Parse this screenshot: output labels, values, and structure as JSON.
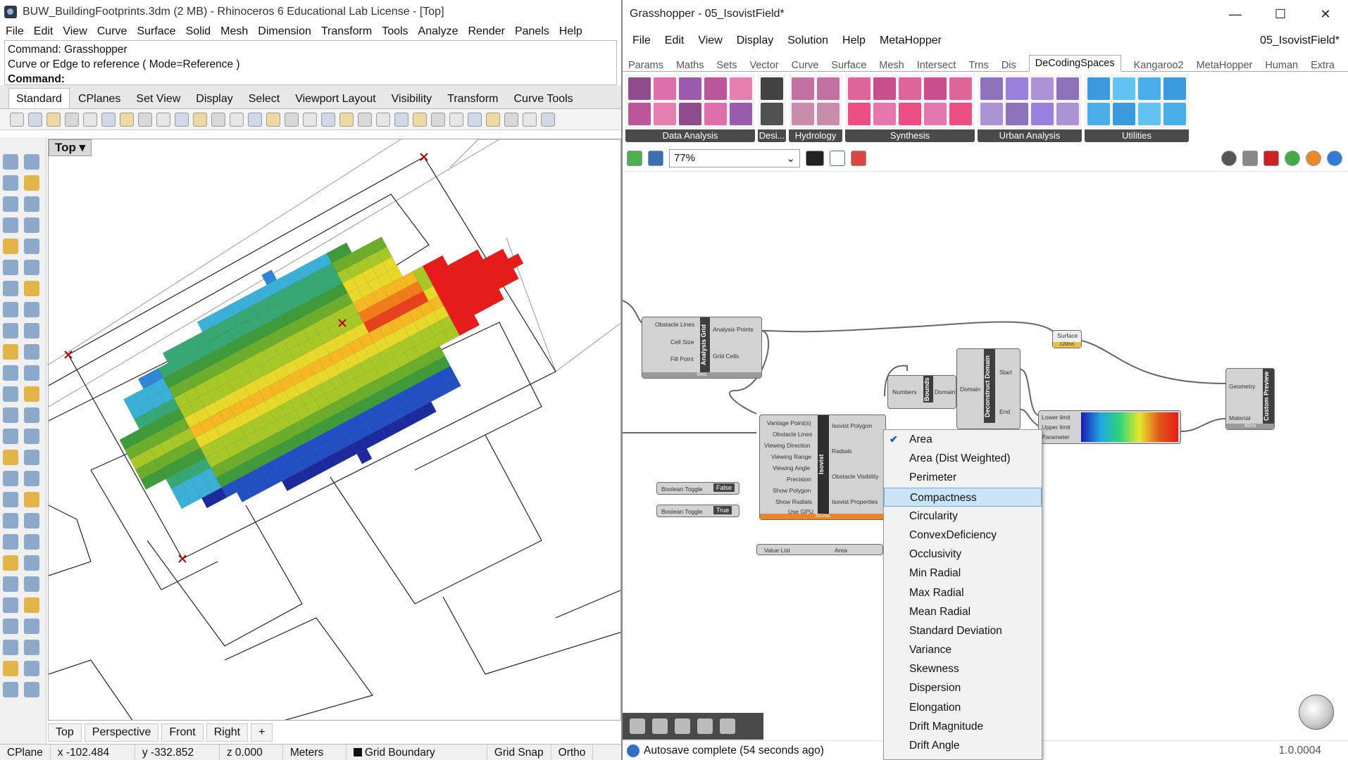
{
  "rhino": {
    "title": "BUW_BuildingFootprints.3dm (2 MB) - Rhinoceros 6 Educational Lab License - [Top]",
    "menu": [
      "File",
      "Edit",
      "View",
      "Curve",
      "Surface",
      "Solid",
      "Mesh",
      "Dimension",
      "Transform",
      "Tools",
      "Analyze",
      "Render",
      "Panels",
      "Help"
    ],
    "command_history": [
      "Command: Grasshopper",
      "Curve or Edge to reference ( Mode=Reference )"
    ],
    "command_prompt": "Command:",
    "toolbar_tabs": [
      "Standard",
      "CPlanes",
      "Set View",
      "Display",
      "Select",
      "Viewport Layout",
      "Visibility",
      "Transform",
      "Curve Tools"
    ],
    "viewport_label": "Top",
    "viewport_tabs": [
      "Top",
      "Perspective",
      "Front",
      "Right",
      "+"
    ],
    "status": {
      "cplane": "CPlane",
      "x": "x -102.484",
      "y": "y -332.852",
      "z": "z 0.000",
      "units": "Meters",
      "layer": "Grid Boundary",
      "snap": "Grid Snap",
      "ortho": "Ortho"
    }
  },
  "gh": {
    "title": "Grasshopper - 05_IsovistField*",
    "doc_name": "05_IsovistField*",
    "menu": [
      "File",
      "Edit",
      "View",
      "Display",
      "Solution",
      "Help",
      "MetaHopper"
    ],
    "component_tabs": [
      "Params",
      "Maths",
      "Sets",
      "Vector",
      "Curve",
      "Surface",
      "Mesh",
      "Intersect",
      "Trns",
      "Dis",
      "DeCodingSpaces",
      "Kangaroo2",
      "MetaHopper",
      "Human",
      "Extra"
    ],
    "active_tab": "DeCodingSpaces",
    "panels": [
      "Data Analysis",
      "Desi...",
      "Hydrology",
      "Synthesis",
      "Urban Analysis",
      "Utilities"
    ],
    "zoom": "77%",
    "components": {
      "grid": {
        "in": [
          "Obstacle Lines",
          "Cell Size",
          "Fill Point"
        ],
        "name": "Analysis Grid",
        "out": [
          "Analysis Points",
          "Grid Cells"
        ],
        "time": "6ms"
      },
      "surface": {
        "name": "Surface",
        "time": "120ms"
      },
      "bounds": {
        "in": "Numbers",
        "name": "Bounds",
        "out": "Domain"
      },
      "deconstruct": {
        "in": "Domain",
        "name": "Deconstruct Domain",
        "out": [
          "Start",
          "End"
        ]
      },
      "gradient": {
        "in": [
          "Lower limit",
          "Upper limit",
          "Parameter"
        ]
      },
      "preview": {
        "in": [
          "Geometry",
          "Material"
        ],
        "name": "Custom Preview",
        "time": "40ms"
      },
      "isovist": {
        "in": [
          "Vantage Point(s)",
          "Obstacle Lines",
          "Viewing Direction",
          "Viewing Range",
          "Viewing Angle",
          "Precision",
          "Show Polygon",
          "Show Radials",
          "Use GPU"
        ],
        "name": "Isovist",
        "out": [
          "Isovist Polygon",
          "Radials",
          "Obstacle Visibility",
          "Isovist Properties"
        ],
        "time": "261ms"
      },
      "toggle1": {
        "name": "Boolean Toggle",
        "value": "False"
      },
      "toggle2": {
        "name": "Boolean Toggle",
        "value": "True"
      },
      "valuelist": {
        "name": "Value List",
        "value": "Area"
      }
    },
    "dropdown": [
      "Area",
      "Area (Dist Weighted)",
      "Perimeter",
      "Compactness",
      "Circularity",
      "ConvexDeficiency",
      "Occlusivity",
      "Min Radial",
      "Max Radial",
      "Mean Radial",
      "Standard Deviation",
      "Variance",
      "Skewness",
      "Dispersion",
      "Elongation",
      "Drift Magnitude",
      "Drift Angle"
    ],
    "dropdown_checked": "Area",
    "dropdown_highlighted": "Compactness",
    "status": "Autosave complete (54 seconds ago)",
    "version": "1.0.0004"
  }
}
